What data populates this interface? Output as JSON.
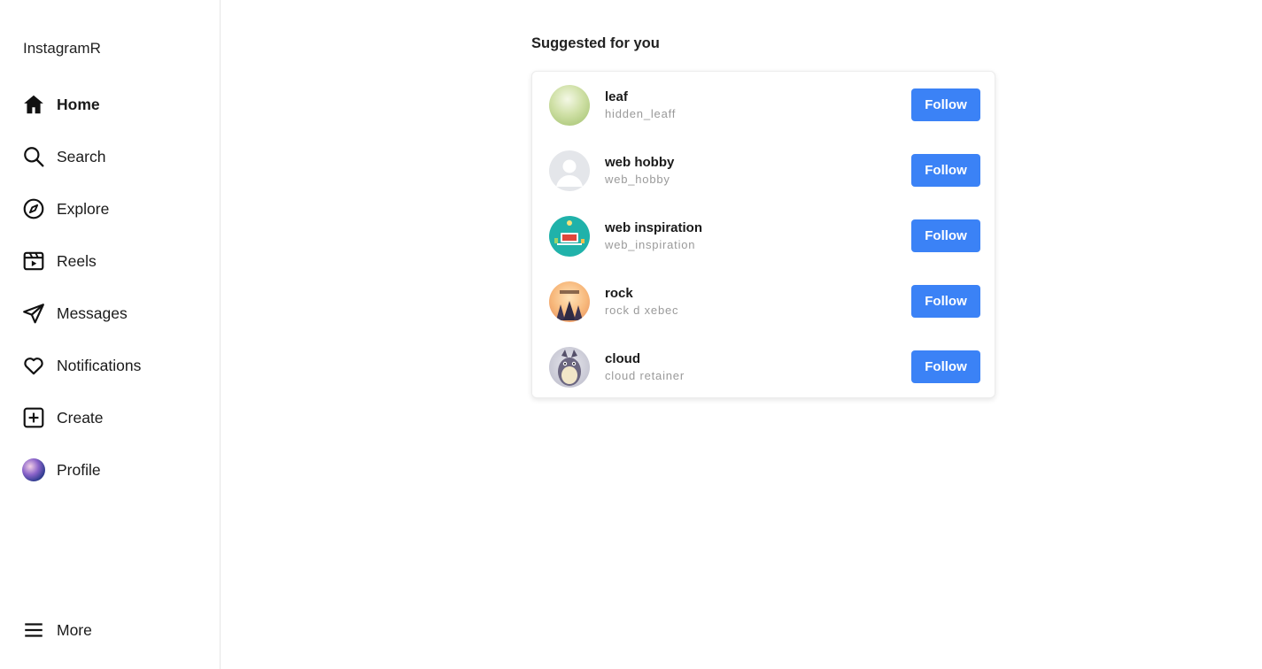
{
  "app": {
    "brand": "InstagramR"
  },
  "sidebar": {
    "items": [
      {
        "label": "Home",
        "icon": "home-icon",
        "active": true
      },
      {
        "label": "Search",
        "icon": "search-icon",
        "active": false
      },
      {
        "label": "Explore",
        "icon": "compass-icon",
        "active": false
      },
      {
        "label": "Reels",
        "icon": "reels-icon",
        "active": false
      },
      {
        "label": "Messages",
        "icon": "send-icon",
        "active": false
      },
      {
        "label": "Notifications",
        "icon": "heart-icon",
        "active": false
      },
      {
        "label": "Create",
        "icon": "plus-square-icon",
        "active": false
      },
      {
        "label": "Profile",
        "icon": "avatar",
        "active": false
      }
    ],
    "more": {
      "label": "More",
      "icon": "menu-icon"
    }
  },
  "suggestions": {
    "title": "Suggested for you",
    "items": [
      {
        "name": "leaf",
        "handle": "hidden_leaff",
        "button": "Follow"
      },
      {
        "name": "web hobby",
        "handle": "web_hobby",
        "button": "Follow"
      },
      {
        "name": "web inspiration",
        "handle": "web_inspiration",
        "button": "Follow"
      },
      {
        "name": "rock",
        "handle": "rock d xebec",
        "button": "Follow"
      },
      {
        "name": "cloud",
        "handle": "cloud retainer",
        "button": "Follow"
      }
    ]
  },
  "colors": {
    "accent": "#3b82f6",
    "text": "#1a1a1a",
    "muted": "#9a9a9a",
    "border": "#e6e6e6"
  }
}
